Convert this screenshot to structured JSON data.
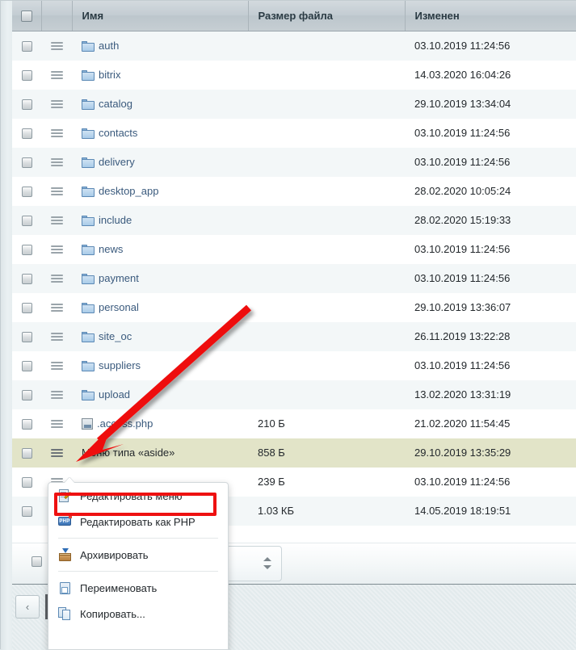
{
  "table": {
    "columns": [
      {
        "key": "check",
        "label": ""
      },
      {
        "key": "menu",
        "label": ""
      },
      {
        "key": "name",
        "label": "Имя"
      },
      {
        "key": "size",
        "label": "Размер файла"
      },
      {
        "key": "date",
        "label": "Изменен"
      }
    ],
    "rows": [
      {
        "icon": "folder-icon",
        "name": "auth",
        "size": "",
        "date": "03.10.2019 11:24:56",
        "selected": false,
        "link": true
      },
      {
        "icon": "folder-icon",
        "name": "bitrix",
        "size": "",
        "date": "14.03.2020 16:04:26",
        "selected": false,
        "link": true
      },
      {
        "icon": "folder-icon",
        "name": "catalog",
        "size": "",
        "date": "29.10.2019 13:34:04",
        "selected": false,
        "link": true
      },
      {
        "icon": "folder-icon",
        "name": "contacts",
        "size": "",
        "date": "03.10.2019 11:24:56",
        "selected": false,
        "link": true
      },
      {
        "icon": "folder-icon",
        "name": "delivery",
        "size": "",
        "date": "03.10.2019 11:24:56",
        "selected": false,
        "link": true
      },
      {
        "icon": "folder-icon",
        "name": "desktop_app",
        "size": "",
        "date": "28.02.2020 10:05:24",
        "selected": false,
        "link": true
      },
      {
        "icon": "folder-icon",
        "name": "include",
        "size": "",
        "date": "28.02.2020 15:19:33",
        "selected": false,
        "link": true
      },
      {
        "icon": "folder-icon",
        "name": "news",
        "size": "",
        "date": "03.10.2019 11:24:56",
        "selected": false,
        "link": true
      },
      {
        "icon": "folder-icon",
        "name": "payment",
        "size": "",
        "date": "03.10.2019 11:24:56",
        "selected": false,
        "link": true
      },
      {
        "icon": "folder-icon",
        "name": "personal",
        "size": "",
        "date": "29.10.2019 13:36:07",
        "selected": false,
        "link": true
      },
      {
        "icon": "folder-icon",
        "name": "site_oc",
        "size": "",
        "date": "26.11.2019 13:22:28",
        "selected": false,
        "link": true
      },
      {
        "icon": "folder-icon",
        "name": "suppliers",
        "size": "",
        "date": "03.10.2019 11:24:56",
        "selected": false,
        "link": true
      },
      {
        "icon": "folder-icon",
        "name": "upload",
        "size": "",
        "date": "13.02.2020 13:31:19",
        "selected": false,
        "link": true
      },
      {
        "icon": "file-icon",
        "name": ".access.php",
        "size": "210 Б",
        "date": "21.02.2020 11:54:45",
        "selected": false,
        "link": true
      },
      {
        "icon": "none",
        "name": "Меню типа «aside»",
        "size": "858 Б",
        "date": "29.10.2019 13:35:29",
        "selected": true,
        "link": false
      },
      {
        "icon": "none",
        "name": "",
        "size": "239 Б",
        "date": "03.10.2019 11:24:56",
        "selected": false,
        "link": false
      },
      {
        "icon": "none",
        "name": "",
        "size": "1.03 КБ",
        "date": "14.05.2019 18:19:51",
        "selected": false,
        "link": false
      }
    ]
  },
  "context_menu": {
    "items": [
      {
        "icon": "edit-document-icon",
        "label": "Редактировать меню",
        "highlighted": true,
        "separator_after": false
      },
      {
        "icon": "php-file-icon",
        "label": "Редактировать как PHP",
        "highlighted": false,
        "separator_after": true
      },
      {
        "icon": "archive-box-icon",
        "label": "Архивировать",
        "highlighted": false,
        "separator_after": true
      },
      {
        "icon": "rename-icon",
        "label": "Переименовать",
        "highlighted": false,
        "separator_after": false
      },
      {
        "icon": "copy-icon",
        "label": "Копировать...",
        "highlighted": false,
        "separator_after": false
      }
    ]
  },
  "toolbar": {
    "select_all_label": "",
    "stepper_value": ""
  },
  "pager": {
    "prev_label": "‹"
  },
  "annotations": {
    "highlight_color": "#ee1111",
    "arrow_color": "#ee1111"
  },
  "colors": {
    "header_bg": "#c3ccd2",
    "row_odd": "#f3f7f8",
    "row_even": "#ffffff",
    "row_selected": "#e2e4c8",
    "link": "#3a5a7d",
    "page_bg": "#e3eaec"
  }
}
